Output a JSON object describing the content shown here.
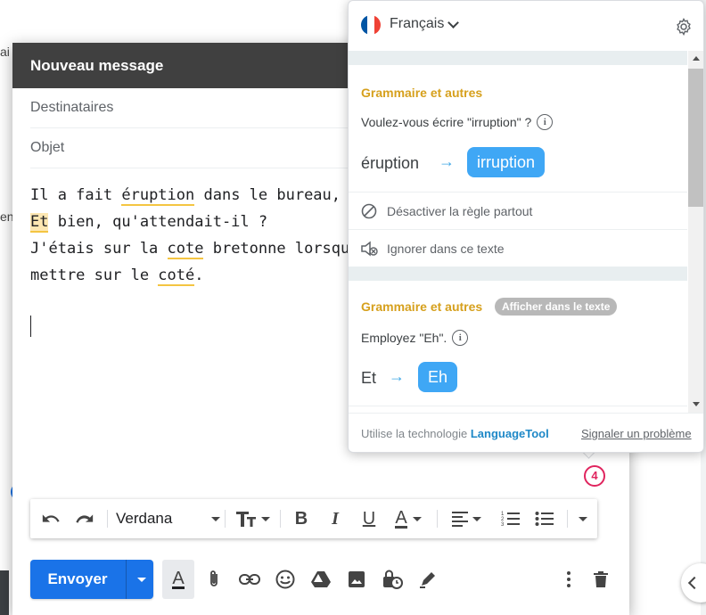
{
  "background": {
    "left_fragment_top": "ai",
    "left_fragment_mid": "en"
  },
  "compose": {
    "title": "Nouveau message",
    "to_placeholder": "Destinataires",
    "subject_placeholder": "Objet",
    "body": {
      "line1_a": "Il a fait ",
      "line1_err": "éruption",
      "line1_b": " dans le bureau, j'a",
      "line2_err": "Et",
      "line2_b": " bien, qu'attendait-il ?",
      "line3_a": "J'étais sur la ",
      "line3_err": "cote",
      "line3_b": " bretonne lorsque",
      "line4_a": "mettre sur le ",
      "line4_err": "coté",
      "line4_b": "."
    },
    "issue_count": "4",
    "toolbar": {
      "font": "Verdana"
    },
    "send_label": "Envoyer"
  },
  "languagetool": {
    "language": "Français",
    "cards": [
      {
        "category": "Grammaire et autres",
        "question": "Voulez-vous écrire \"irruption\" ?",
        "original": "éruption",
        "suggestion": "irruption",
        "actions": [
          "Désactiver la règle partout",
          "Ignorer dans ce texte"
        ]
      },
      {
        "category": "Grammaire et autres",
        "tag": "Afficher dans le texte",
        "question": "Employez \"Eh\".",
        "original": "Et",
        "suggestion": "Eh"
      }
    ],
    "footer": {
      "tech_prefix": "Utilise la technologie ",
      "tech_name": "LanguageTool",
      "report": "Signaler un problème"
    }
  },
  "colors": {
    "accent_blue": "#1a73e8",
    "lt_suggestion": "#3fa7f5",
    "lt_category": "#d6a01d",
    "badge": "#e0245e",
    "header_dark": "#404040"
  }
}
